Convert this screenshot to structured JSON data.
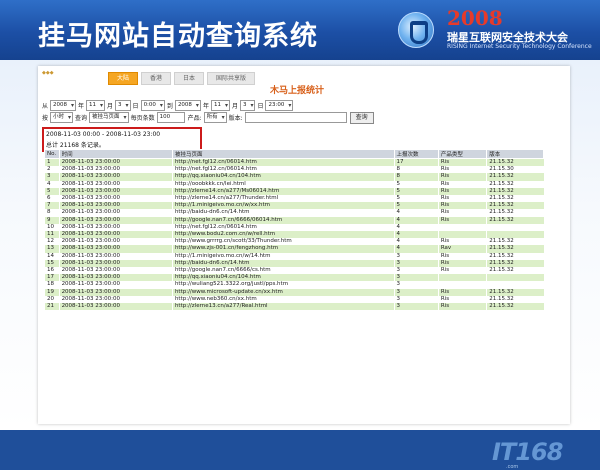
{
  "header": {
    "title": "挂马网站自动查询系统",
    "conf_year": "2008",
    "conf_name": "瑞星互联网安全技术大会",
    "conf_en": "RISING Internet Security Technology Conference"
  },
  "tabs": [
    {
      "label": "大陆",
      "active": true
    },
    {
      "label": "香港",
      "active": false
    },
    {
      "label": "日本",
      "active": false
    },
    {
      "label": "国际共享版",
      "active": false
    }
  ],
  "stats_title": "木马上报统计",
  "filters": {
    "from_label": "从",
    "from": {
      "year": "2008",
      "month": "11",
      "day": "3",
      "time": "0:00"
    },
    "year_unit": "年",
    "month_unit": "月",
    "day_unit": "日",
    "to_label": "到",
    "to": {
      "year": "2008",
      "month": "11",
      "day": "3",
      "time": "23:00"
    },
    "by_label": "按",
    "unit_value": "小时",
    "query_label": "查询",
    "field_value": "被挂马页面",
    "per_page_label": "每页条数",
    "per_page_value": "100",
    "product_label": "产品:",
    "product_value": "所有",
    "version_label": "版本:",
    "version_value": "",
    "search_button": "查询"
  },
  "summary": {
    "range": "2008-11-03 00:00 - 2008-11-03 23:00",
    "total": "总计 21168 条记录。"
  },
  "table": {
    "columns": [
      "No.",
      "时间",
      "被挂马页面",
      "上报次数",
      "产品类型",
      "版本"
    ],
    "rows": [
      [
        "1",
        "2008-11-03 23:00:00",
        "http://net.fgl12.cn/06014.htm",
        "17",
        "Ris",
        "21.15.32"
      ],
      [
        "2",
        "2008-11-03 23:00:00",
        "http://net.fgl12.cn/06014.htm",
        "8",
        "Ris",
        "21.15.30"
      ],
      [
        "3",
        "2008-11-03 23:00:00",
        "http://qq.xiaoniu04.cn/104.htm",
        "8",
        "Ris",
        "21.15.32"
      ],
      [
        "4",
        "2008-11-03 23:00:00",
        "http://ooobkkk.cn/lei.html",
        "5",
        "Ris",
        "21.15.32"
      ],
      [
        "5",
        "2008-11-03 23:00:00",
        "http://zlerne14.cn/a277/Ms06014.htm",
        "5",
        "Ris",
        "21.15.32"
      ],
      [
        "6",
        "2008-11-03 23:00:00",
        "http://zlerne14.cn/a277/Thunder.html",
        "5",
        "Ris",
        "21.15.32"
      ],
      [
        "7",
        "2008-11-03 23:00:00",
        "http://1.minigeivo.mo.cn/w/xx.htm",
        "5",
        "Ris",
        "21.15.32"
      ],
      [
        "8",
        "2008-11-03 23:00:00",
        "http://baidu-dn6.cn/14.htm",
        "4",
        "Ris",
        "21.15.32"
      ],
      [
        "9",
        "2008-11-03 23:00:00",
        "http://google.nan7.cn/6666/06014.htm",
        "4",
        "Ris",
        "21.15.32"
      ],
      [
        "10",
        "2008-11-03 23:00:00",
        "http://net.fgl12.cn/06014.htm",
        "4",
        "",
        ""
      ],
      [
        "11",
        "2008-11-03 23:00:00",
        "http://www.bodu2.com.cn/w/rell.htm",
        "4",
        "",
        ""
      ],
      [
        "12",
        "2008-11-03 23:00:00",
        "http://www.grrrrg.cn/scott/33/Thunder.htm",
        "4",
        "Ris",
        "21.15.32"
      ],
      [
        "13",
        "2008-11-03 23:00:00",
        "http://www.zjs-001.cn/fengzhong.htm",
        "4",
        "Rav",
        "21.15.32"
      ],
      [
        "14",
        "2008-11-03 23:00:00",
        "http://1.minigeivo.mo.cn/w/14.htm",
        "3",
        "Ris",
        "21.15.32"
      ],
      [
        "15",
        "2008-11-03 23:00:00",
        "http://baidu-dn6.cn/14.htm",
        "3",
        "Ris",
        "21.15.32"
      ],
      [
        "16",
        "2008-11-03 23:00:00",
        "http://google.nan7.cn/6666/cs.htm",
        "3",
        "Ris",
        "21.15.32"
      ],
      [
        "17",
        "2008-11-03 23:00:00",
        "http://qq.xiaoniu04.cn/104.htm",
        "3",
        "",
        ""
      ],
      [
        "18",
        "2008-11-03 23:00:00",
        "http://wuliang521.3322.org/justl/pps.htm",
        "3",
        "",
        ""
      ],
      [
        "19",
        "2008-11-03 23:00:00",
        "http://www.microsoft-update.cn/xx.htm",
        "3",
        "Ris",
        "21.15.32"
      ],
      [
        "20",
        "2008-11-03 23:00:00",
        "http://www.neb360.cn/xx.htm",
        "3",
        "Ris",
        "21.15.32"
      ],
      [
        "21",
        "2008-11-03 23:00:00",
        "http://zlerne13.cn/a277/Real.html",
        "3",
        "Ris",
        "21.15.32"
      ]
    ]
  },
  "watermark": {
    "text": "IT168",
    "sub": ".com"
  },
  "colors": {
    "header_bg": "#1c4fa5",
    "accent_orange": "#f5a623",
    "highlight_red": "#cc1b1b",
    "row_green": "#dcefc8"
  }
}
